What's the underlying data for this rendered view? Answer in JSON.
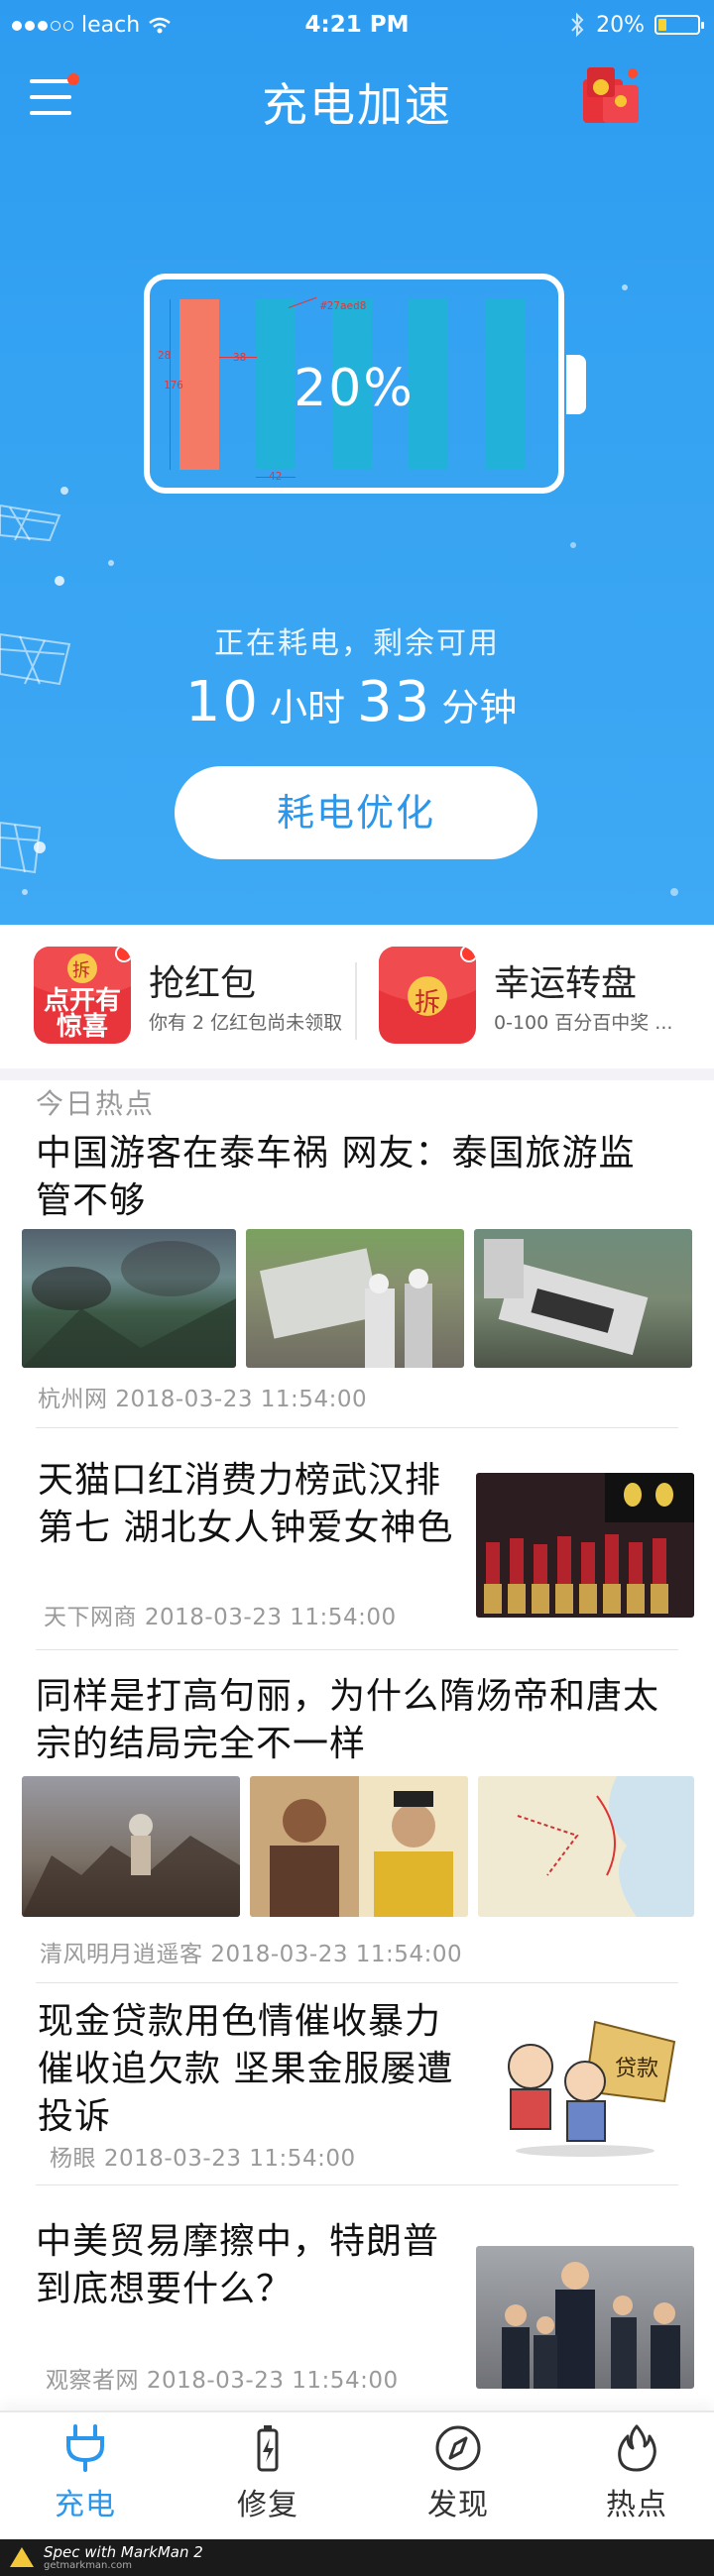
{
  "status_bar": {
    "carrier": "leach",
    "time": "4:21 PM",
    "battery_percent": "20%"
  },
  "header": {
    "title": "充电加速"
  },
  "battery": {
    "percent_label": "20%",
    "level": 0.2,
    "annotations": {
      "a1": "#27aed8",
      "a2": "28",
      "a3": "38",
      "a4": "176",
      "a5": "42"
    },
    "status_text": "正在耗电，剩余可用",
    "hours": "10",
    "hours_unit": "小时",
    "minutes": "33",
    "minutes_unit": "分钟",
    "optimize_button": "耗电优化",
    "colors": {
      "active_cell": "#f47a66",
      "idle_cell": "#22b1d8"
    }
  },
  "promos": [
    {
      "title": "抢红包",
      "subtitle": "你有 2 亿红包尚未领取",
      "icon": "red-envelope-surprise-icon",
      "icon_text": "点开有惊喜",
      "badge_char": "拆"
    },
    {
      "title": "幸运转盘",
      "subtitle": "0-100 百分百中奖 ...",
      "icon": "red-envelope-icon",
      "badge_char": "拆"
    }
  ],
  "news": {
    "section_title": "今日热点",
    "items": [
      {
        "title": "中国游客在泰车祸 网友：泰国旅游监管不够",
        "source": "杭州网",
        "time": "2018-03-23 11:54:00"
      },
      {
        "title": "天猫口红消费力榜武汉排第七 湖北女人钟爱女神色",
        "source": "天下网商",
        "time": "2018-03-23 11:54:00"
      },
      {
        "title": "同样是打高句丽，为什么隋炀帝和唐太宗的结局完全不一样",
        "source": "清风明月逍遥客",
        "time": "2018-03-23 11:54:00"
      },
      {
        "title": "现金贷款用色情催收暴力催收追欠款 坚果金服屡遭投诉",
        "source": "杨眼",
        "time": "2018-03-23 11:54:00"
      },
      {
        "title": "中美贸易摩擦中，特朗普到底想要什么？",
        "source": "观察者网",
        "time": "2018-03-23 11:54:00"
      }
    ]
  },
  "tabs": [
    {
      "label": "充电",
      "icon": "plug-icon",
      "active": true
    },
    {
      "label": "修复",
      "icon": "battery-icon",
      "active": false
    },
    {
      "label": "发现",
      "icon": "compass-icon",
      "active": false
    },
    {
      "label": "热点",
      "icon": "flame-icon",
      "active": false
    }
  ],
  "colors": {
    "accent": "#2a97ec",
    "tab_inactive": "#333333"
  },
  "footer": {
    "line1": "Spec with MarkMan 2",
    "line2": "getmarkman.com"
  }
}
